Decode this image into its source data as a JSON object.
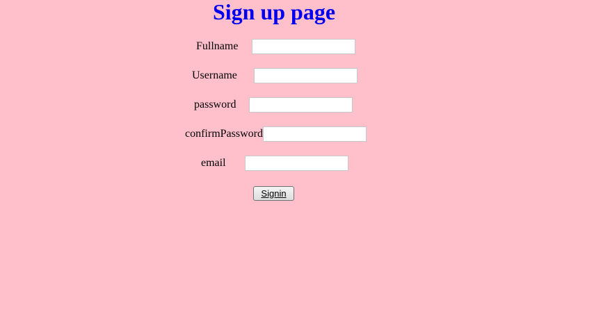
{
  "page": {
    "title": "Sign up page",
    "background_color": "#ffc0cb",
    "title_color": "#0000ee"
  },
  "form": {
    "fields": [
      {
        "label": "Fullname",
        "value": "",
        "placeholder": ""
      },
      {
        "label": "Username",
        "value": "",
        "placeholder": ""
      },
      {
        "label": "password",
        "value": "",
        "placeholder": ""
      },
      {
        "label": "confirmPassword",
        "value": "",
        "placeholder": ""
      },
      {
        "label": "email",
        "value": "",
        "placeholder": ""
      }
    ],
    "submit_label": "Signin"
  }
}
